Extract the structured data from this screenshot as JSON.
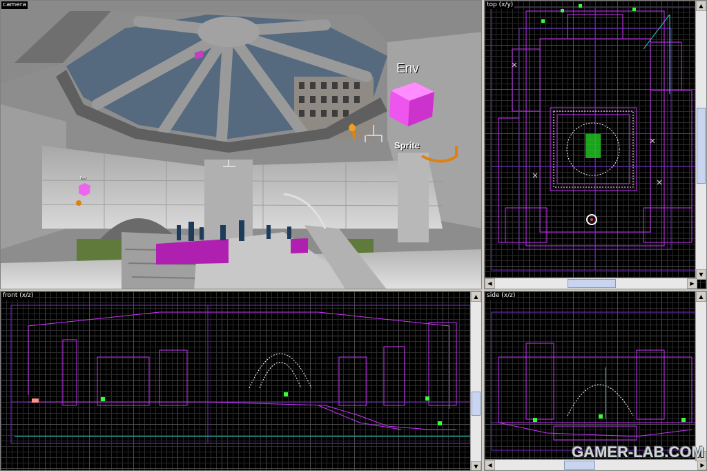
{
  "viewports": {
    "camera": {
      "label": "camera"
    },
    "top": {
      "label": "top (x/y)"
    },
    "front": {
      "label": "front (x/z)"
    },
    "side": {
      "label": "side (x/z)"
    }
  },
  "entities": {
    "env_label": "Env",
    "sprite_label": "Sprite",
    "env_small_label": "Env"
  },
  "scrollbars": {
    "up_arrow": "▲",
    "down_arrow": "▼",
    "left_arrow": "◀",
    "right_arrow": "▶"
  },
  "watermark": "GAMER-LAB.COM",
  "colors": {
    "grid": "#2a2a2a",
    "brush_magenta": "#cc33ff",
    "brush_purple": "#7a2ad0",
    "entity_white": "#ffffff",
    "entity_green": "#33ff33",
    "sky": "#5a6f86"
  },
  "icons": {
    "env_cube": "magenta-cube-icon",
    "sprite": "sprite-icon",
    "light": "light-bulb-icon"
  }
}
